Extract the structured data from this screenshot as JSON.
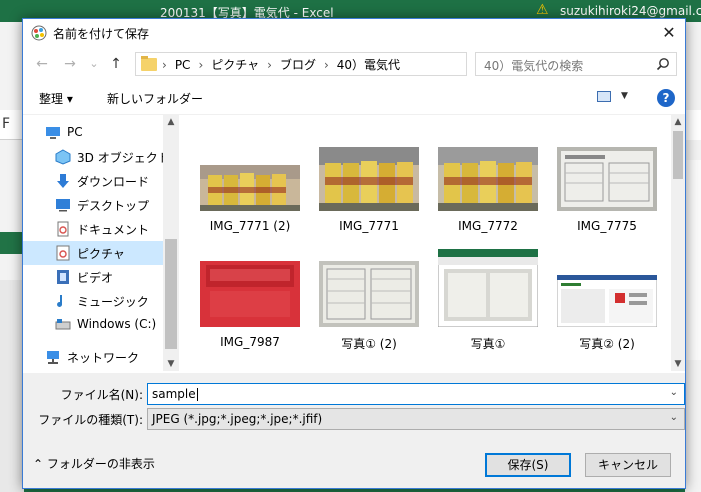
{
  "excel": {
    "title": "200131【写真】電気代 - Excel",
    "user": "suzukihiroki24@gmail.co",
    "font_letter": "F"
  },
  "dialog": {
    "title": "名前を付けて保存",
    "close": "✕"
  },
  "navigation": {
    "back": "←",
    "forward": "→",
    "recent": "⌄",
    "up": "↑",
    "breadcrumb": [
      "PC",
      "ピクチャ",
      "ブログ",
      "40）電気代"
    ],
    "breadcrumb_sep": "›",
    "refresh": "↻",
    "search_placeholder": "40）電気代の検索"
  },
  "toolbar": {
    "organize": "整理 ▾",
    "new_folder": "新しいフォルダー",
    "help": "?"
  },
  "sidebar": {
    "items": [
      {
        "label": "PC",
        "icon": "pc-icon"
      },
      {
        "label": "3D オブジェクト",
        "icon": "3d-objects-icon"
      },
      {
        "label": "ダウンロード",
        "icon": "download-icon"
      },
      {
        "label": "デスクトップ",
        "icon": "desktop-icon"
      },
      {
        "label": "ドキュメント",
        "icon": "documents-icon"
      },
      {
        "label": "ピクチャ",
        "icon": "pictures-icon",
        "selected": true
      },
      {
        "label": "ビデオ",
        "icon": "video-icon"
      },
      {
        "label": "ミュージック",
        "icon": "music-icon"
      },
      {
        "label": "Windows (C:)",
        "icon": "drive-icon"
      },
      {
        "label": "ネットワーク",
        "icon": "network-icon"
      }
    ]
  },
  "files": [
    {
      "name": "IMG_7771 (2)",
      "kind": "cans"
    },
    {
      "name": "IMG_7771",
      "kind": "cans"
    },
    {
      "name": "IMG_7772",
      "kind": "cans"
    },
    {
      "name": "IMG_7775",
      "kind": "doc"
    },
    {
      "name": "IMG_7987",
      "kind": "laptop"
    },
    {
      "name": "写真① (2)",
      "kind": "doc"
    },
    {
      "name": "写真①",
      "kind": "sheet"
    },
    {
      "name": "写真② (2)",
      "kind": "screen"
    }
  ],
  "form": {
    "filename_label": "ファイル名(N):",
    "filename_value": "sample",
    "filetype_label": "ファイルの種類(T):",
    "filetype_value": "JPEG (*.jpg;*.jpeg;*.jpe;*.jfif)"
  },
  "footer": {
    "hide_folders": "フォルダーの非表示",
    "save": "保存(S)",
    "cancel": "キャンセル"
  },
  "colors": {
    "accent": "#0078d7",
    "excel_green": "#1e7145",
    "selected_nav": "#cce8ff"
  }
}
